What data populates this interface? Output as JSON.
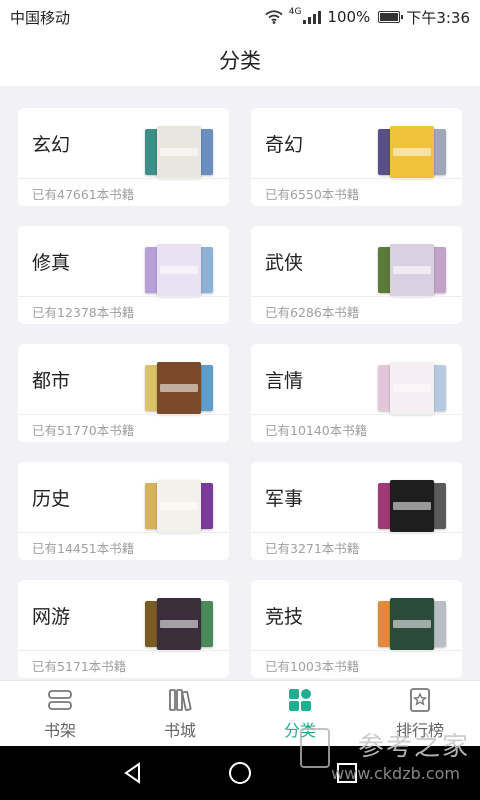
{
  "status": {
    "carrier": "中国移动",
    "network": "4G",
    "battery": "100%",
    "time": "下午3:36"
  },
  "header": {
    "title": "分类"
  },
  "categories": [
    {
      "name": "玄幻",
      "count": "已有47661本书籍",
      "colors": [
        "#3b8f86",
        "#e9e6df",
        "#6a8fbf"
      ]
    },
    {
      "name": "奇幻",
      "count": "已有6550本书籍",
      "colors": [
        "#5a4f8a",
        "#f0c23b",
        "#a0a8b8"
      ]
    },
    {
      "name": "修真",
      "count": "已有12378本书籍",
      "colors": [
        "#b7a0d8",
        "#e8e2f2",
        "#8fb1d6"
      ]
    },
    {
      "name": "武侠",
      "count": "已有6286本书籍",
      "colors": [
        "#5c7a3a",
        "#d9d0e2",
        "#c3a3c8"
      ]
    },
    {
      "name": "都市",
      "count": "已有51770本书籍",
      "colors": [
        "#d8c26a",
        "#7a4a2a",
        "#5d9fca"
      ]
    },
    {
      "name": "言情",
      "count": "已有10140本书籍",
      "colors": [
        "#e3c7d8",
        "#f5eef2",
        "#b7c9e0"
      ]
    },
    {
      "name": "历史",
      "count": "已有14451本书籍",
      "colors": [
        "#d6b25c",
        "#f3f1ec",
        "#7b3b9b"
      ]
    },
    {
      "name": "军事",
      "count": "已有3271本书籍",
      "colors": [
        "#a03a76",
        "#1e1e1e",
        "#5a5a5a"
      ]
    },
    {
      "name": "网游",
      "count": "已有5171本书籍",
      "colors": [
        "#7a5c22",
        "#3a2e3a",
        "#4a8a5a"
      ]
    },
    {
      "name": "竞技",
      "count": "已有1003本书籍",
      "colors": [
        "#e08b3c",
        "#2b4a3a",
        "#b8bec4"
      ]
    }
  ],
  "nav": [
    {
      "label": "书架",
      "icon": "bookshelf-icon",
      "active": false
    },
    {
      "label": "书城",
      "icon": "bookstore-icon",
      "active": false
    },
    {
      "label": "分类",
      "icon": "category-grid-icon",
      "active": true
    },
    {
      "label": "排行榜",
      "icon": "ranking-icon",
      "active": false
    }
  ],
  "accent": "#1fae8f",
  "watermark": {
    "text": "参考之家",
    "url": "www.ckdzb.com"
  }
}
